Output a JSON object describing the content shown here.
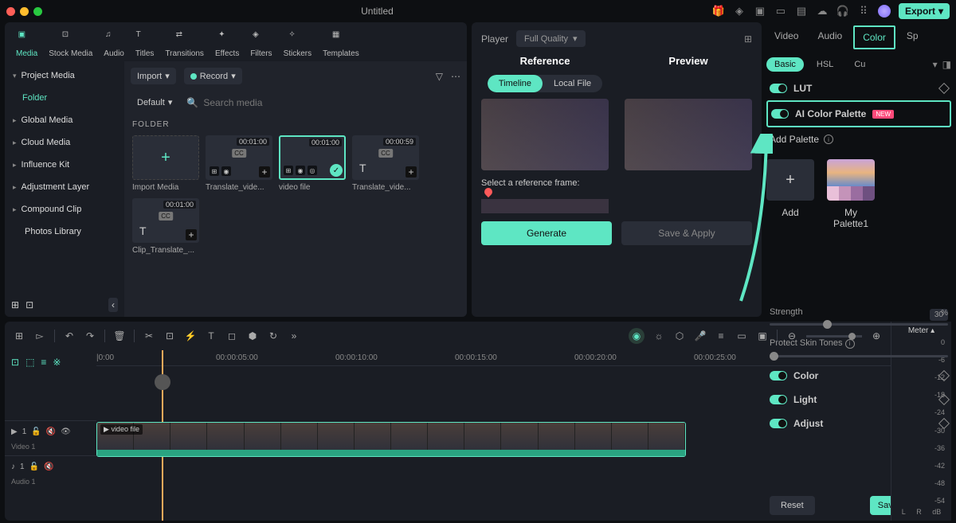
{
  "titlebar": {
    "title": "Untitled",
    "export": "Export"
  },
  "mediaTabs": [
    "Media",
    "Stock Media",
    "Audio",
    "Titles",
    "Transitions",
    "Effects",
    "Filters",
    "Stickers",
    "Templates"
  ],
  "tree": {
    "project": "Project Media",
    "folder": "Folder",
    "items": [
      "Global Media",
      "Cloud Media",
      "Influence Kit",
      "Adjustment Layer",
      "Compound Clip",
      "Photos Library"
    ]
  },
  "contentTop": {
    "import": "Import",
    "record": "Record",
    "default": "Default",
    "search": "Search media",
    "folder": "FOLDER"
  },
  "thumbs": [
    {
      "name": "Import Media",
      "dur": "",
      "type": "import"
    },
    {
      "name": "Translate_vide...",
      "dur": "00:01:00",
      "type": "cc"
    },
    {
      "name": "video file",
      "dur": "00:01:00",
      "type": "sel"
    },
    {
      "name": "Translate_vide...",
      "dur": "00:00:59",
      "type": "cc2"
    },
    {
      "name": "Clip_Translate_...",
      "dur": "00:01:00",
      "type": "cc"
    }
  ],
  "center": {
    "player": "Player",
    "quality": "Full Quality",
    "reference": "Reference",
    "preview": "Preview",
    "timeline": "Timeline",
    "localfile": "Local File",
    "select": "Select a reference frame:",
    "generate": "Generate",
    "saveapply": "Save & Apply"
  },
  "right": {
    "tabs": [
      "Video",
      "Audio",
      "Color",
      "Sp"
    ],
    "subtabs": [
      "Basic",
      "HSL",
      "Cu"
    ],
    "lut": "LUT",
    "aicolor": "AI Color Palette",
    "new": "NEW",
    "addpalette": "Add Palette",
    "add": "Add",
    "mypalette": "My Palette1",
    "strength": "Strength",
    "strengthVal": "30",
    "pct": "%",
    "protect": "Protect Skin Tones",
    "protectVal": "0",
    "color": "Color",
    "light": "Light",
    "adjust": "Adjust",
    "reset": "Reset",
    "savecustom": "Save as custom"
  },
  "timeline": {
    "meter": "Meter",
    "ticks": [
      "|0:00",
      "00:00:05:00",
      "00:00:10:00",
      "00:00:15:00",
      "00:00:20:00",
      "00:00:25:00"
    ],
    "clipname": "video file",
    "video1": "Video 1",
    "audio1": "Audio 1",
    "dbvals": [
      "0",
      "-6",
      "-12",
      "-18",
      "-24",
      "-30",
      "-36",
      "-42",
      "-48",
      "-54"
    ],
    "dbunit": "dB",
    "L": "L",
    "R": "R"
  }
}
